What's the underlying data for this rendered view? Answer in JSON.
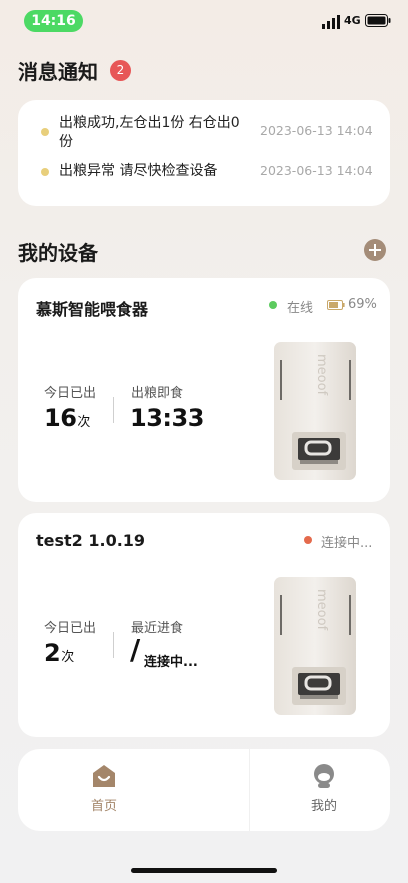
{
  "status_bar": {
    "time": "14:16",
    "network": "4G"
  },
  "notifications": {
    "title": "消息通知",
    "badge_count": "2",
    "items": [
      {
        "text": "出粮成功,左仓出1份 右仓出0份",
        "time": "2023-06-13 14:04"
      },
      {
        "text": "出粮异常 请尽快检查设备",
        "time": "2023-06-13 14:04"
      }
    ]
  },
  "devices": {
    "title": "我的设备",
    "list": [
      {
        "name": "慕斯智能喂食器",
        "status": "在线",
        "status_color": "#5ccb5f",
        "battery": "69%",
        "stat1_label": "今日已出",
        "stat1_value": "16",
        "stat1_unit": "次",
        "stat2_label": "出粮即食",
        "stat2_value": "13:33",
        "brand": "meoof"
      },
      {
        "name": "test2 1.0.19",
        "status": "连接中...",
        "status_color": "#e46a4c",
        "stat1_label": "今日已出",
        "stat1_value": "2",
        "stat1_unit": "次",
        "stat2_label": "最近进食",
        "stat2_value": "/",
        "stat2_suffix": "连接中...",
        "brand": "meoof"
      }
    ]
  },
  "tabs": {
    "home": "首页",
    "mine": "我的"
  },
  "colors": {
    "accent": "#a4866a",
    "badge": "#e75757",
    "notif_dot": "#e8cf7c"
  }
}
